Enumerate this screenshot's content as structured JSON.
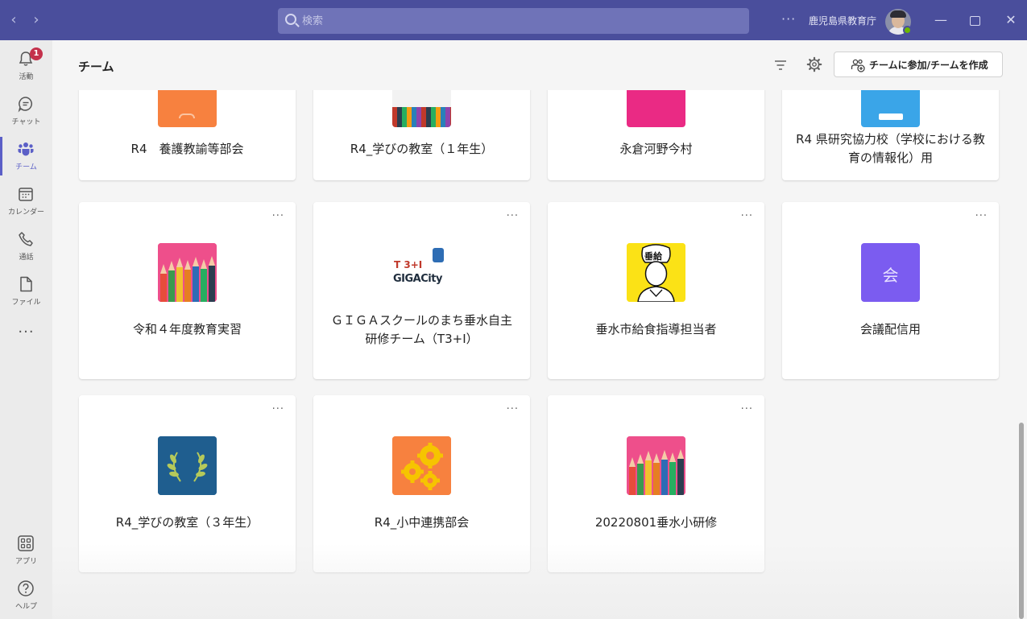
{
  "titlebar": {
    "back": "‹",
    "forward": "›",
    "search_placeholder": "検索",
    "more": "···",
    "org_name": "鹿児島県教育庁",
    "minimize": "—",
    "close": "✕"
  },
  "rail": {
    "items": [
      {
        "label": "活動",
        "badge": "1"
      },
      {
        "label": "チャット"
      },
      {
        "label": "チーム"
      },
      {
        "label": "カレンダー"
      },
      {
        "label": "通話"
      },
      {
        "label": "ファイル"
      }
    ],
    "more": "···",
    "apps_label": "アプリ",
    "help_label": "ヘルプ"
  },
  "header": {
    "title": "チーム",
    "join_label": "チームに参加/チームを作成"
  },
  "card_menu": "···",
  "teams": [
    {
      "name": "R4　養護教諭等部会",
      "tile": "orange"
    },
    {
      "name": "R4_学びの教室（１年生）",
      "tile": "pencils"
    },
    {
      "name": "永倉河野今村",
      "tile": "pink"
    },
    {
      "name": "R4 県研究協力校（学校における教育の情報化）用",
      "tile": "blue"
    },
    {
      "name": "令和４年度教育実習",
      "tile": "pencils"
    },
    {
      "name": "ＧＩＧＡスクールのまち垂水自主研修チーム（T3+I）",
      "tile": "gigacity",
      "logo_top": "T 3+I",
      "logo_bottom": "GIGACity"
    },
    {
      "name": "垂水市給食指導担当者",
      "tile": "chef",
      "tile_text": "垂給"
    },
    {
      "name": "会議配信用",
      "tile": "purple",
      "tile_text": "会"
    },
    {
      "name": "R4_学びの教室（３年生）",
      "tile": "laurel"
    },
    {
      "name": "R4_小中連携部会",
      "tile": "gears"
    },
    {
      "name": "20220801垂水小研修",
      "tile": "pencils"
    }
  ],
  "colors": {
    "titlebar": "#4a4e9c",
    "accent": "#5b5fc7",
    "badge": "#c4314b",
    "presence": "#6bb700",
    "orange": "#f7813f",
    "pink": "#ea2a84",
    "blue": "#3aa5e8",
    "purple": "#7b5cf0",
    "navy": "#1f5e8f"
  }
}
